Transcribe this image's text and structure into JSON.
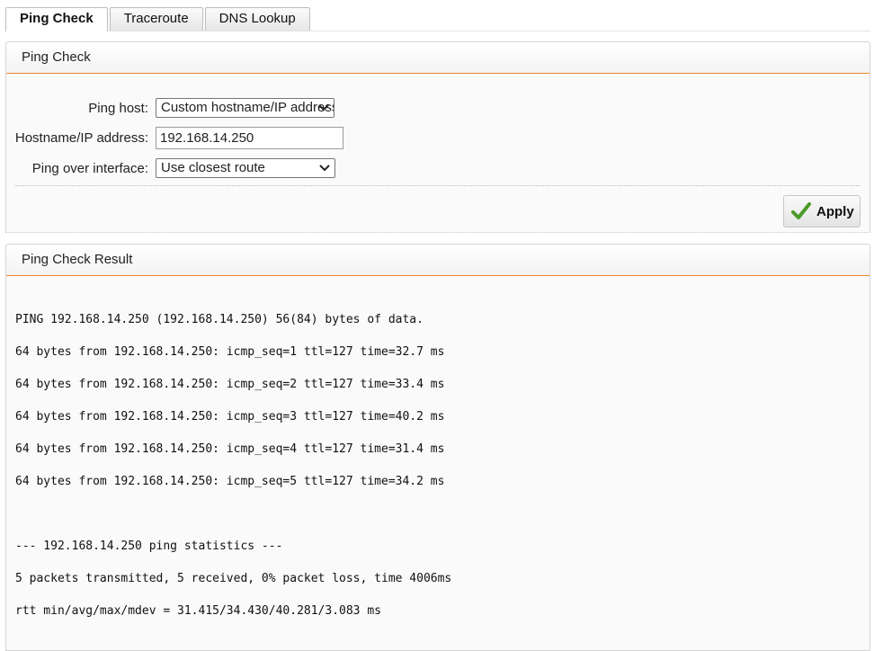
{
  "tabs": [
    {
      "label": "Ping Check",
      "active": true
    },
    {
      "label": "Traceroute",
      "active": false
    },
    {
      "label": "DNS Lookup",
      "active": false
    }
  ],
  "config_panel": {
    "title": "Ping Check",
    "ping_host_label": "Ping host:",
    "ping_host_value": "Custom hostname/IP address",
    "hostname_label": "Hostname/IP address:",
    "hostname_value": "192.168.14.250",
    "interface_label": "Ping over interface:",
    "interface_value": "Use closest route",
    "apply_label": "Apply"
  },
  "result_panel": {
    "title": "Ping Check Result",
    "lines": [
      "PING 192.168.14.250 (192.168.14.250) 56(84) bytes of data.",
      "64 bytes from 192.168.14.250: icmp_seq=1 ttl=127 time=32.7 ms",
      "64 bytes from 192.168.14.250: icmp_seq=2 ttl=127 time=33.4 ms",
      "64 bytes from 192.168.14.250: icmp_seq=3 ttl=127 time=40.2 ms",
      "64 bytes from 192.168.14.250: icmp_seq=4 ttl=127 time=31.4 ms",
      "64 bytes from 192.168.14.250: icmp_seq=5 ttl=127 time=34.2 ms",
      "",
      "--- 192.168.14.250 ping statistics ---",
      "5 packets transmitted, 5 received, 0% packet loss, time 4006ms",
      "rtt min/avg/max/mdev = 31.415/34.430/40.281/3.083 ms"
    ]
  },
  "colors": {
    "accent": "#ec8a2c",
    "check_green": "#4a9a2a"
  }
}
